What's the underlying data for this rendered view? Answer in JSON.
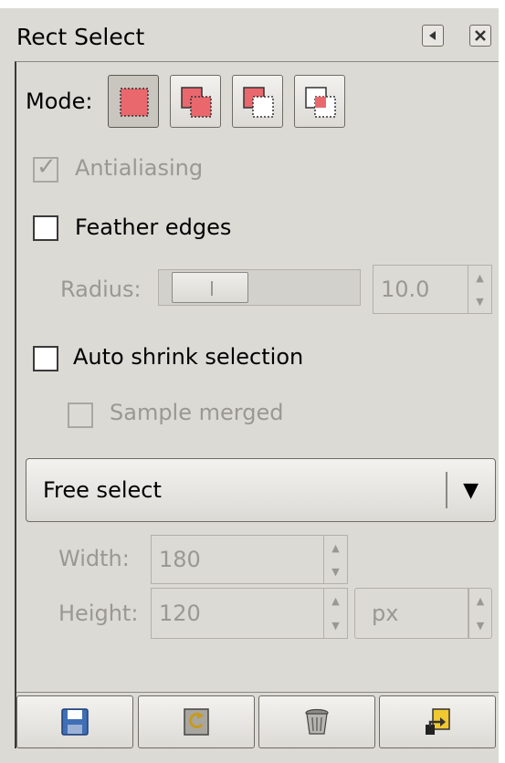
{
  "panel": {
    "title": "Rect Select"
  },
  "mode": {
    "label": "Mode:",
    "options": [
      "replace",
      "add",
      "subtract",
      "intersect"
    ],
    "selected": "replace"
  },
  "antialiasing": {
    "label": "Antialiasing",
    "checked": true,
    "enabled": false
  },
  "feather": {
    "label": "Feather edges",
    "checked": false,
    "radius_label": "Radius:",
    "radius_value": "10.0"
  },
  "auto_shrink": {
    "label": "Auto shrink selection",
    "checked": false
  },
  "sample_merged": {
    "label": "Sample merged",
    "checked": false,
    "enabled": false
  },
  "select_mode": {
    "value": "Free select"
  },
  "size": {
    "width_label": "Width:",
    "width_value": "180",
    "height_label": "Height:",
    "height_value": "120",
    "unit": "px"
  },
  "colors": {
    "fill": "#e8686e",
    "panel": "#dcdad5"
  },
  "bottom_buttons": [
    "save-icon",
    "restore-icon",
    "delete-icon",
    "reset-icon"
  ]
}
